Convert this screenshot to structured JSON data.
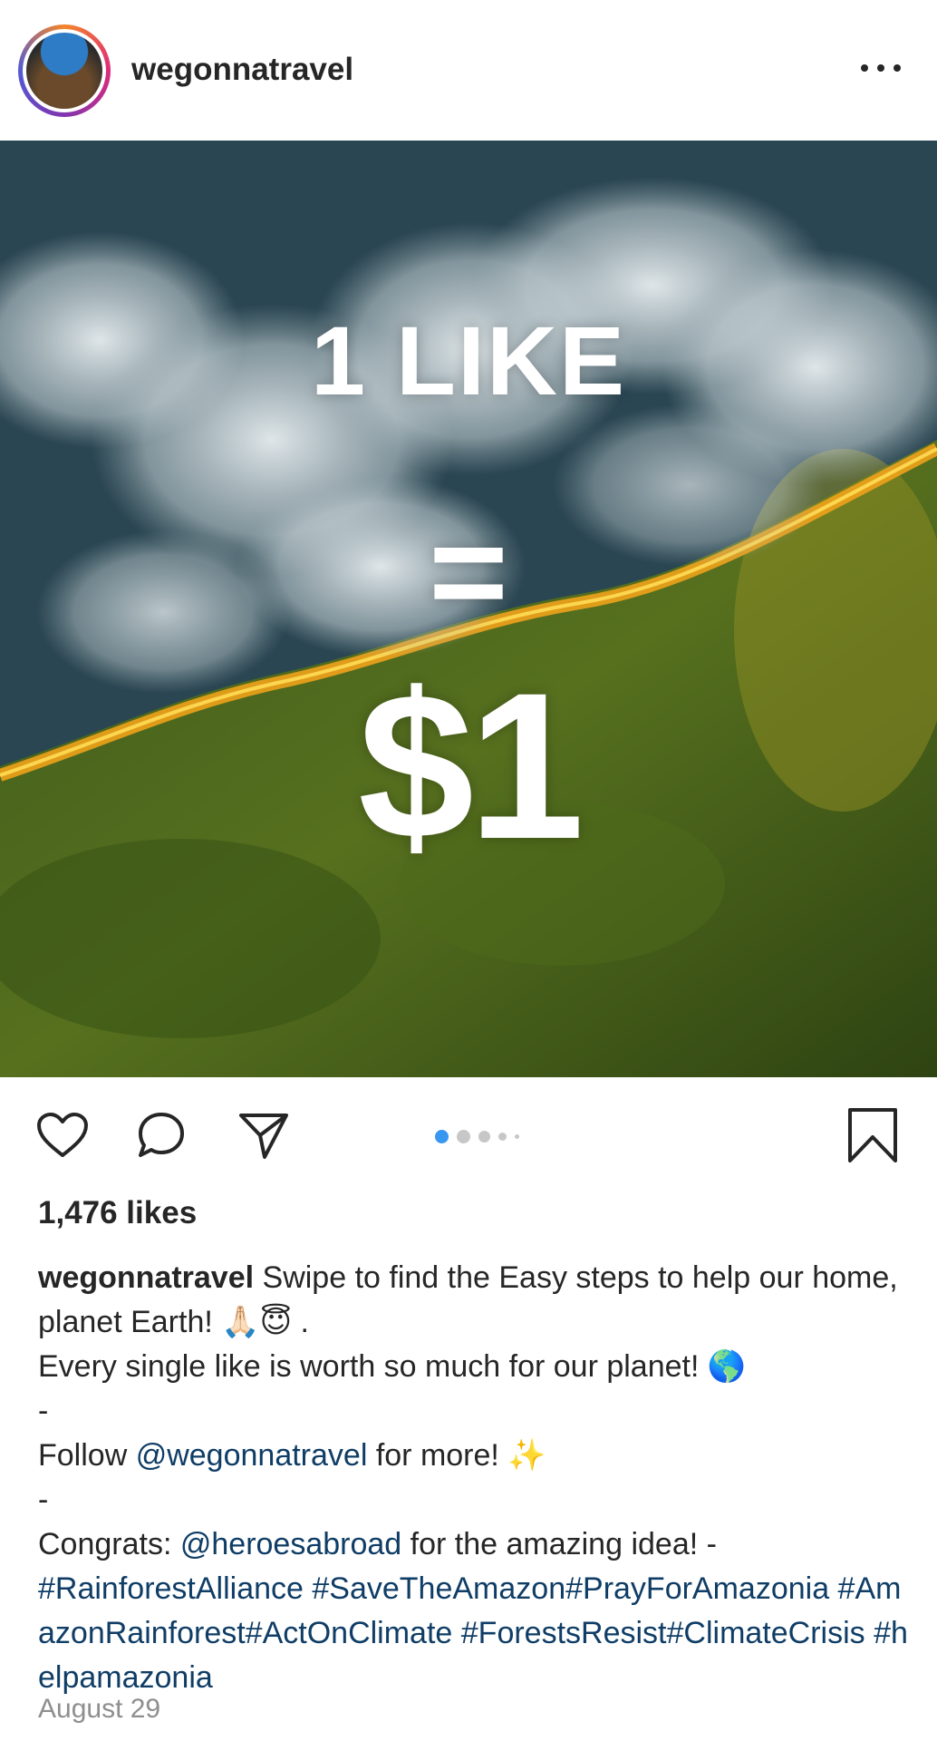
{
  "header": {
    "username": "wegonnatravel",
    "more_icon": "ellipsis-icon"
  },
  "image": {
    "line1": "1 LIKE",
    "line2": "=",
    "line3": "$1",
    "carousel_index": 1,
    "carousel_count": 5
  },
  "actions": {
    "like_icon": "heart-icon",
    "comment_icon": "comment-icon",
    "share_icon": "send-icon",
    "save_icon": "bookmark-icon"
  },
  "likes": "1,476 likes",
  "caption": {
    "username": "wegonnatravel",
    "line1": " Swipe to find the Easy steps to help our home, planet Earth! 🙏🏻😇 .",
    "line2": "Every single like is worth so much for our planet! 🌎",
    "dash1": "-",
    "follow_pre": "Follow ",
    "follow_mention": "@wegonnatravel",
    "follow_post": " for more! ✨",
    "dash2": "-",
    "congrats_pre": "Congrats: ",
    "congrats_mention": "@heroesabroad",
    "congrats_post": " for the amazing idea! -",
    "hashtags": "#RainforestAlliance #SaveTheAmazon#PrayForAmazonia #AmazonRainforest#ActOnClimate #ForestsResist#ClimateCrisis #helpamazonia"
  },
  "date": "August 29",
  "colors": {
    "text": "#262626",
    "link": "#0f3d66",
    "muted": "#8e8e8e",
    "active_dot": "#3897f0"
  }
}
